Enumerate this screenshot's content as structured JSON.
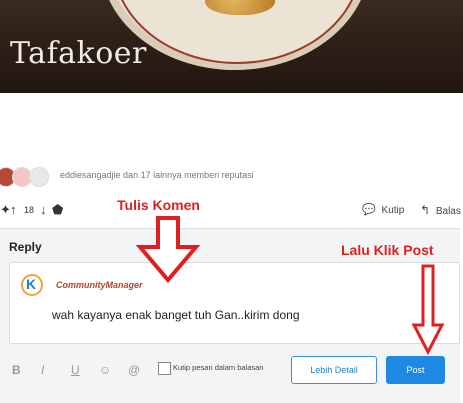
{
  "banner": {
    "brand": "Tafakoer"
  },
  "reputation": {
    "text": "eddiesangadjie dan 17 lainnya memberi reputasi"
  },
  "actions": {
    "score": "18",
    "quote_label": "Kutip",
    "reply_label": "Balas"
  },
  "annotations": {
    "comment_hint": "Tulis Komen",
    "post_hint": "Lalu Klik Post"
  },
  "reply": {
    "title": "Reply",
    "user": "CommunityManager",
    "logo_letter": "K",
    "text": "wah kayanya enak banget tuh Gan..kirim dong",
    "toolbar": {
      "bold": "B",
      "italic": "I",
      "underline": "U",
      "emoji": "☺",
      "mention": "@"
    },
    "quote_checkbox_label": "Kutip pesan dalam balasan",
    "detail_button": "Lebih Detail",
    "post_button": "Post"
  },
  "colors": {
    "accent": "#1e88e5",
    "annotation": "#e02020",
    "username": "#b8412c"
  }
}
